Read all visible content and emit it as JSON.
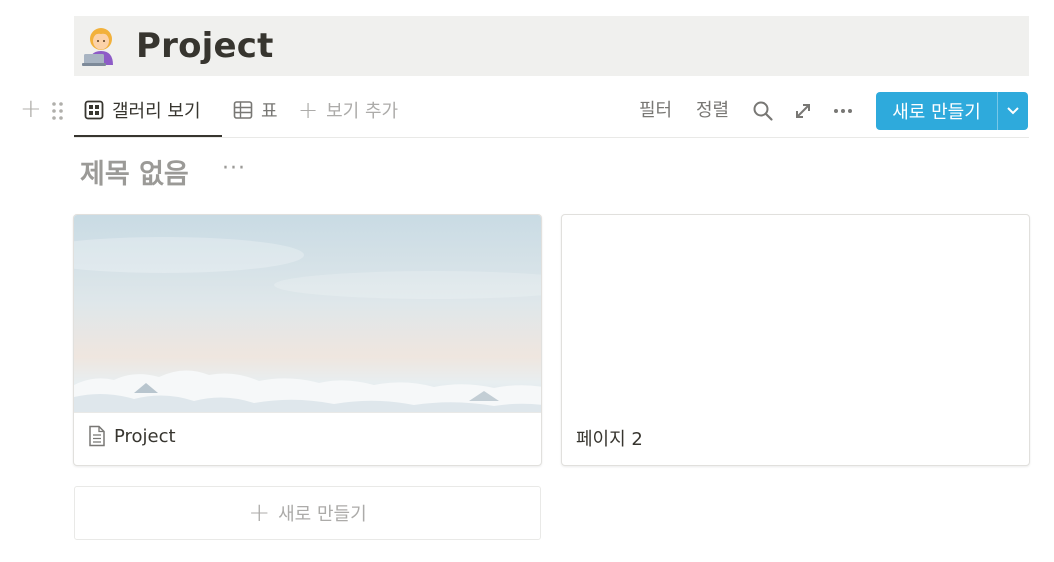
{
  "page": {
    "title": "Project",
    "icon": "person-with-laptop-emoji"
  },
  "toolbar": {
    "views": [
      {
        "label": "갤러리 보기",
        "icon": "gallery-icon",
        "active": true
      },
      {
        "label": "표",
        "icon": "table-icon",
        "active": false
      }
    ],
    "add_view_label": "보기 추가",
    "filter_label": "필터",
    "sort_label": "정렬",
    "new_button_label": "새로 만들기",
    "accent_color": "#2eaadc"
  },
  "group": {
    "title": "제목 없음",
    "more": "···"
  },
  "cards": [
    {
      "title": "Project",
      "has_cover": true,
      "icon": "document-icon"
    },
    {
      "title": "페이지 2",
      "has_cover": false
    }
  ],
  "new_row_label": "새로 만들기"
}
